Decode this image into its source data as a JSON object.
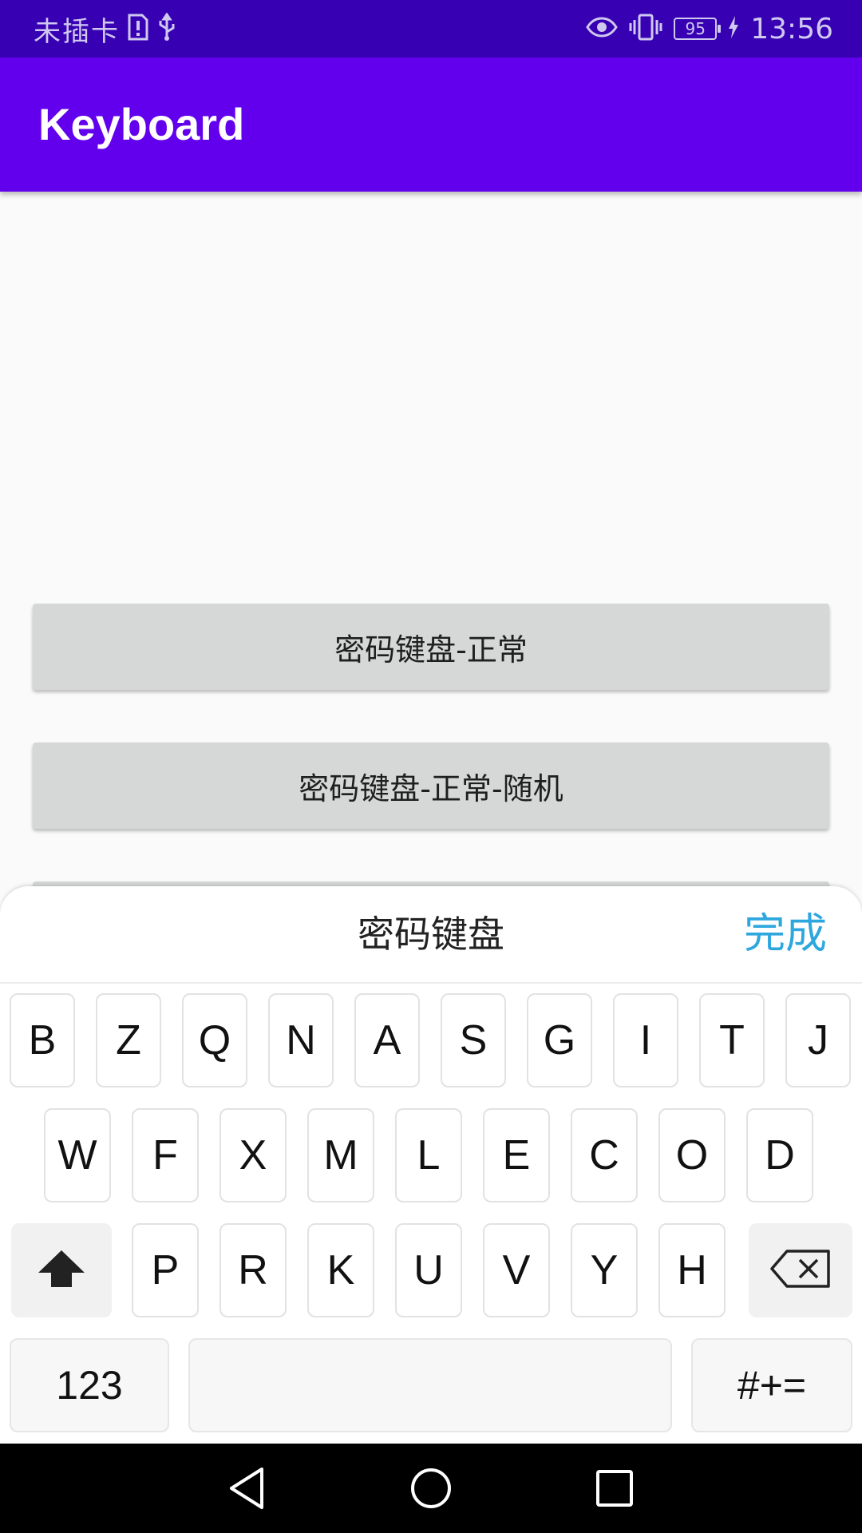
{
  "status_bar": {
    "carrier": "未插卡",
    "battery": "95",
    "time": "13:56",
    "icons": [
      "sim-alert-icon",
      "usb-icon",
      "eye-icon",
      "vibrate-icon",
      "battery-icon",
      "charging-icon"
    ]
  },
  "app_bar": {
    "title": "Keyboard"
  },
  "buttons": [
    {
      "label": "密码键盘-正常"
    },
    {
      "label": "密码键盘-正常-随机"
    }
  ],
  "keyboard": {
    "title": "密码键盘",
    "done": "完成",
    "row1": [
      "B",
      "Z",
      "Q",
      "N",
      "A",
      "S",
      "G",
      "I",
      "T",
      "J"
    ],
    "row2": [
      "W",
      "F",
      "X",
      "M",
      "L",
      "E",
      "C",
      "O",
      "D"
    ],
    "row3": [
      "P",
      "R",
      "K",
      "U",
      "V",
      "Y",
      "H"
    ],
    "numbers_label": "123",
    "symbols_label": "#+=",
    "fn_icons": [
      "shift-icon",
      "backspace-icon"
    ]
  },
  "nav_bar": {
    "icons": [
      "back-icon",
      "home-icon",
      "recents-icon"
    ]
  },
  "colors": {
    "status_bar": "#3700b3",
    "app_bar": "#6200ee",
    "done_text": "#2ea7df"
  }
}
